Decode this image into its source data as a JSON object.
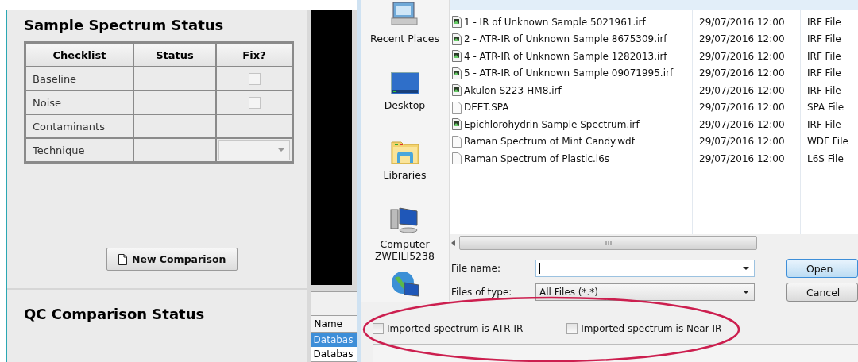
{
  "status_panel": {
    "title": "Sample Spectrum Status",
    "columns": [
      "Checklist",
      "Status",
      "Fix?"
    ],
    "rows": [
      {
        "checklist": "Baseline",
        "fix": {
          "kind": "checkbox",
          "checked": false
        }
      },
      {
        "checklist": "Noise",
        "fix": {
          "kind": "checkbox",
          "checked": false
        }
      },
      {
        "checklist": "Contaminants",
        "fix": {
          "kind": "none"
        }
      },
      {
        "checklist": "Technique",
        "fix": {
          "kind": "dropdown"
        }
      }
    ],
    "new_comparison_button": "New Comparison",
    "qc_title": "QC Comparison Status"
  },
  "side_list": {
    "columns": [
      "Name"
    ],
    "rows": [
      {
        "name": "Databas",
        "selected": true
      },
      {
        "name": "Databas",
        "selected": false
      }
    ]
  },
  "dialog": {
    "places": [
      {
        "kind": "recent",
        "label": "Recent Places"
      },
      {
        "kind": "desktop",
        "label": "Desktop"
      },
      {
        "kind": "libraries",
        "label": "Libraries"
      },
      {
        "kind": "computer",
        "label": "Computer",
        "sublabel": "ZWEILI5238"
      },
      {
        "kind": "network"
      }
    ],
    "files": [
      {
        "kind": "spectrum",
        "name": "1 - IR of Unknown Sample 5021961.irf",
        "date": "29/07/2016 12:00",
        "type": "IRF File"
      },
      {
        "kind": "spectrum",
        "name": "2 - ATR-IR of Unknown Sample 8675309.irf",
        "date": "29/07/2016 12:00",
        "type": "IRF File"
      },
      {
        "kind": "spectrum",
        "name": "4 - ATR-IR of Unknown Sample 1282013.irf",
        "date": "29/07/2016 12:00",
        "type": "IRF File"
      },
      {
        "kind": "spectrum",
        "name": "5 - ATR-IR of Unknown Sample 09071995.irf",
        "date": "29/07/2016 12:00",
        "type": "IRF File"
      },
      {
        "kind": "spectrum",
        "name": "Akulon S223-HM8.irf",
        "date": "29/07/2016 12:00",
        "type": "IRF File"
      },
      {
        "kind": "blank",
        "name": "DEET.SPA",
        "date": "29/07/2016 12:00",
        "type": "SPA File"
      },
      {
        "kind": "spectrum",
        "name": "Epichlorohydrin Sample Spectrum.irf",
        "date": "29/07/2016 12:00",
        "type": "IRF File"
      },
      {
        "kind": "blank",
        "name": "Raman Spectrum of Mint Candy.wdf",
        "date": "29/07/2016 12:00",
        "type": "WDF File"
      },
      {
        "kind": "blank",
        "name": "Raman Spectrum of Plastic.l6s",
        "date": "29/07/2016 12:00",
        "type": "L6S File"
      }
    ],
    "file_name": {
      "label": "File name:"
    },
    "files_of_type": {
      "label": "Files of type:",
      "value": "All Files (*.*)"
    },
    "buttons": [
      {
        "label": "Open",
        "default": true
      },
      {
        "label": "Cancel",
        "default": false
      }
    ],
    "options": [
      {
        "label": "Imported spectrum is ATR-IR",
        "checked": false
      },
      {
        "label": "Imported spectrum is Near IR",
        "checked": false
      }
    ]
  }
}
